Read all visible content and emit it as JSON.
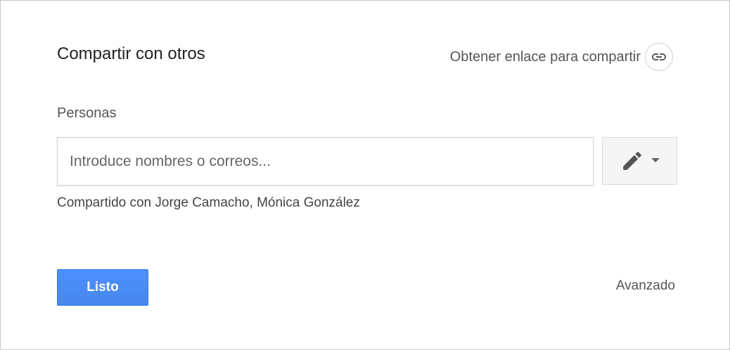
{
  "dialog": {
    "title": "Compartir con otros",
    "get_link_label": "Obtener enlace para compartir",
    "get_link_icon": "link-icon",
    "people_label": "Personas",
    "people_input": {
      "placeholder": "Introduce nombres o correos...",
      "value": ""
    },
    "permission_button": {
      "icon": "pencil-icon",
      "dropdown_icon": "caret-down-icon"
    },
    "shared_with_text": "Compartido con Jorge Camacho, Mónica González",
    "done_label": "Listo",
    "advanced_label": "Avanzado"
  },
  "colors": {
    "primary_button": "#4d90fe",
    "text_primary": "#222222",
    "text_secondary": "#555555",
    "icon_gray": "#666666"
  }
}
